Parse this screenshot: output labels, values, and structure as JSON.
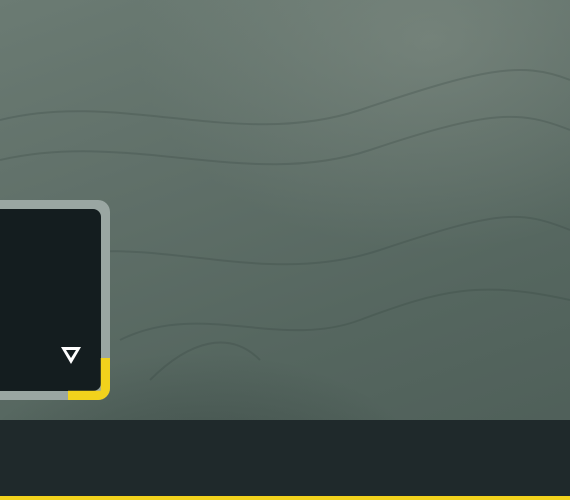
{
  "theme": {
    "accent": "#f2d21c",
    "background": "#5f6f68",
    "panel": "#141d1f",
    "panel_frame": "#9aa6a2",
    "bottom_bar": "#1f292b"
  },
  "card": {
    "icon": "triangle-down-icon"
  },
  "bottom_bar": {
    "accent_line": "#f2d21c"
  }
}
